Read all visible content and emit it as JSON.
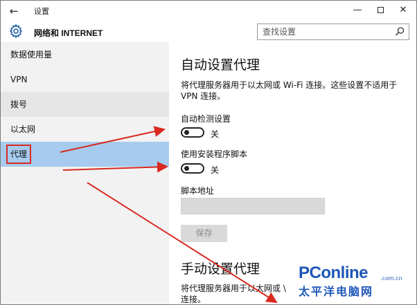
{
  "window": {
    "title": "设置",
    "back_glyph": "←",
    "minimize_glyph": "—",
    "close_glyph": "✕"
  },
  "header": {
    "app_title": "网络和 INTERNET",
    "search_placeholder": "查找设置"
  },
  "sidebar": {
    "items": [
      {
        "label": "数据使用量"
      },
      {
        "label": "VPN"
      },
      {
        "label": "拨号"
      },
      {
        "label": "以太网"
      },
      {
        "label": "代理"
      }
    ],
    "selected_index": 4
  },
  "main": {
    "auto_section": {
      "title": "自动设置代理",
      "description": "将代理服务器用于以太网或 Wi-Fi 连接。这些设置不适用于 VPN 连接。",
      "auto_detect": {
        "label": "自动检测设置",
        "state": "关",
        "on": false
      },
      "use_script": {
        "label": "使用安装程序脚本",
        "state": "关",
        "on": false
      },
      "script_address": {
        "label": "脚本地址",
        "value": ""
      },
      "save_label": "保存"
    },
    "manual_section": {
      "title": "手动设置代理",
      "description": "将代理服务器用于以太网或 \\ 连接。"
    }
  },
  "watermark": {
    "brand": "PConline",
    "domain": ".com.cn",
    "chinese": "太平洋电脑网"
  },
  "colors": {
    "accent_selected": "#a6cbef",
    "sidebar_bg": "#f2f2f2",
    "annotation_red": "#d9281f",
    "watermark_blue": "#1e56b9"
  },
  "icons": {
    "back": "back-arrow-icon",
    "settings": "gear-icon",
    "search": "search-icon",
    "minimize": "minimize-icon",
    "maximize": "maximize-icon",
    "close": "close-icon"
  }
}
